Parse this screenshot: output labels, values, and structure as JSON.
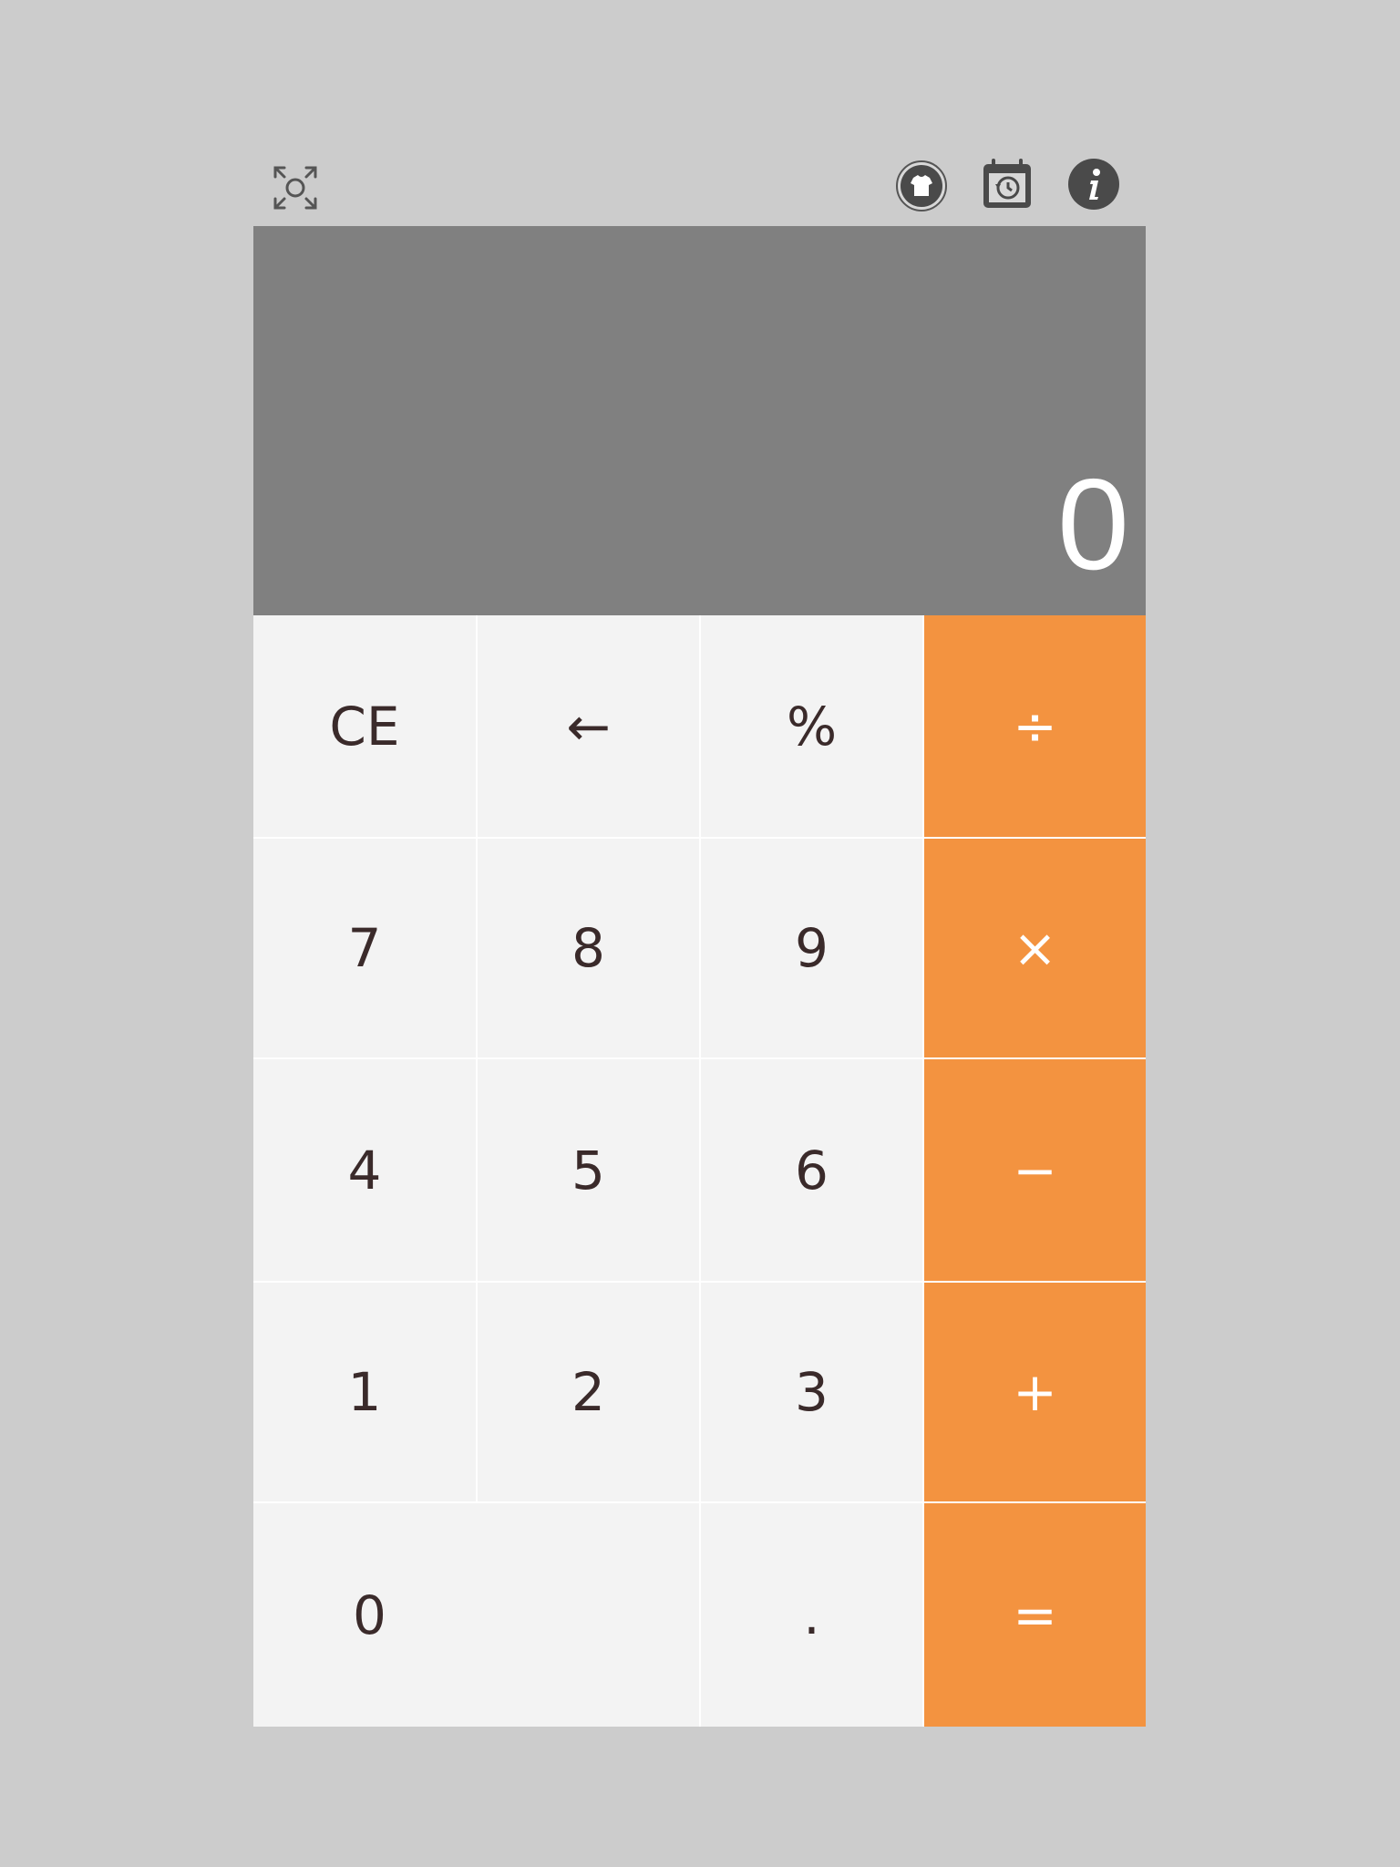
{
  "toolbar": {
    "left_icon": "fullscreen-focus-icon",
    "right_icons": [
      "theme-shirt-icon",
      "history-calendar-icon",
      "info-icon"
    ]
  },
  "display": {
    "value": "0"
  },
  "keys": {
    "ce": "CE",
    "backspace": "←",
    "percent": "%",
    "divide": "÷",
    "seven": "7",
    "eight": "8",
    "nine": "9",
    "multiply": "×",
    "four": "4",
    "five": "5",
    "six": "6",
    "minus": "−",
    "one": "1",
    "two": "2",
    "three": "3",
    "plus": "+",
    "zero": "0",
    "dot": ".",
    "equals": "="
  },
  "colors": {
    "background": "#cccccc",
    "display": "#808080",
    "key": "#f3f3f3",
    "operator": "#f39340",
    "icon": "#4a4a4a"
  }
}
